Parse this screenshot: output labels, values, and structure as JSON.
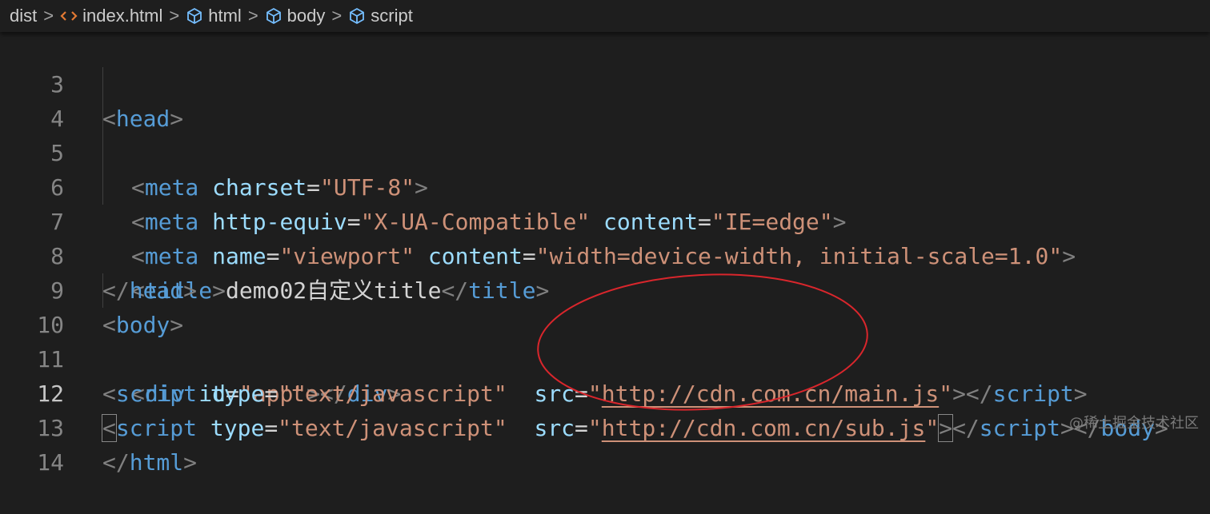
{
  "breadcrumb": {
    "items": [
      {
        "label": "dist",
        "icon": "none"
      },
      {
        "label": "index.html",
        "icon": "html-file-icon"
      },
      {
        "label": "html",
        "icon": "symbol-element-icon"
      },
      {
        "label": "body",
        "icon": "symbol-element-icon"
      },
      {
        "label": "script",
        "icon": "symbol-element-icon"
      }
    ],
    "separator": ">"
  },
  "editor": {
    "active_line": 12,
    "lines": [
      {
        "num": "3"
      },
      {
        "num": "4"
      },
      {
        "num": "5"
      },
      {
        "num": "6"
      },
      {
        "num": "7"
      },
      {
        "num": "8"
      },
      {
        "num": "9"
      },
      {
        "num": "10"
      },
      {
        "num": "11"
      },
      {
        "num": "12"
      },
      {
        "num": "13"
      },
      {
        "num": "14"
      }
    ],
    "tokens": {
      "lt": "<",
      "gt": ">",
      "close_lt": "</",
      "eq": "=",
      "head": "head",
      "meta": "meta",
      "title_tag": "title",
      "body": "body",
      "div": "div",
      "script": "script",
      "html": "html",
      "charset": "charset",
      "charset_val": "\"UTF-8\"",
      "http_equiv": "http-equiv",
      "http_equiv_val": "\"X-UA-Compatible\"",
      "content": "content",
      "content_val_1": "\"IE=edge\"",
      "name": "name",
      "name_val": "\"viewport\"",
      "content_val_2": "\"width=device-width, initial-scale=1.0\"",
      "title_text": "demo02自定义title",
      "id": "id",
      "id_val": "\"app\"",
      "type": "type",
      "type_val": "\"text/javascript\"",
      "src": "src",
      "quote": "\"",
      "src_url_1": "http://cdn.com.cn/main.js",
      "src_url_2": "http://cdn.com.cn/sub.js"
    }
  },
  "annotation": {
    "color": "#d9262c"
  },
  "watermark": "@稀土掘金技术社区",
  "colors": {
    "background": "#1e1e1e",
    "tag": "#569cd6",
    "attribute": "#9cdcfe",
    "string": "#ce9178",
    "punctuation": "#808080",
    "text": "#d4d4d4"
  }
}
